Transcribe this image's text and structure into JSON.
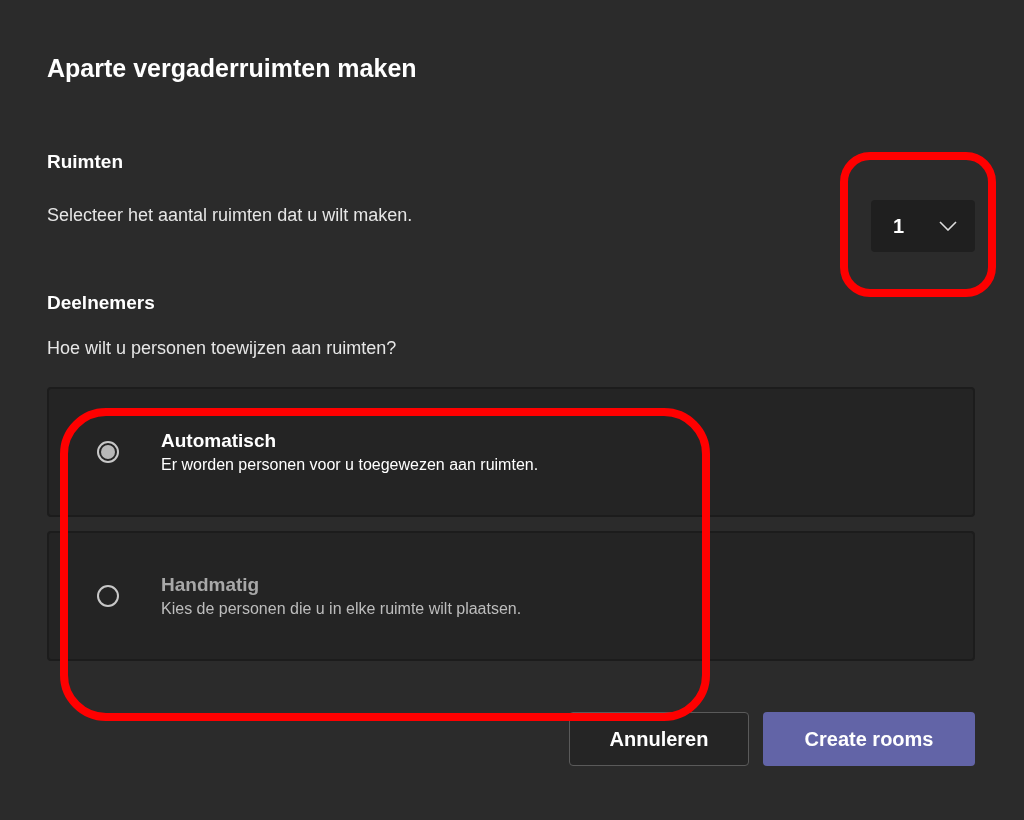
{
  "dialog": {
    "title": "Aparte vergaderruimten maken"
  },
  "rooms": {
    "heading": "Ruimten",
    "description": "Selecteer het aantal ruimten dat u wilt maken.",
    "count": "1"
  },
  "participants": {
    "heading": "Deelnemers",
    "question": "Hoe wilt u personen toewijzen aan ruimten?",
    "options": [
      {
        "label": "Automatisch",
        "description": "Er worden personen voor u toegewezen aan ruimten.",
        "selected": true
      },
      {
        "label": "Handmatig",
        "description": "Kies de personen die u in elke ruimte wilt plaatsen.",
        "selected": false
      }
    ]
  },
  "buttons": [
    {
      "label": "Annuleren",
      "kind": "secondary"
    },
    {
      "label": "Create rooms",
      "kind": "primary"
    }
  ]
}
